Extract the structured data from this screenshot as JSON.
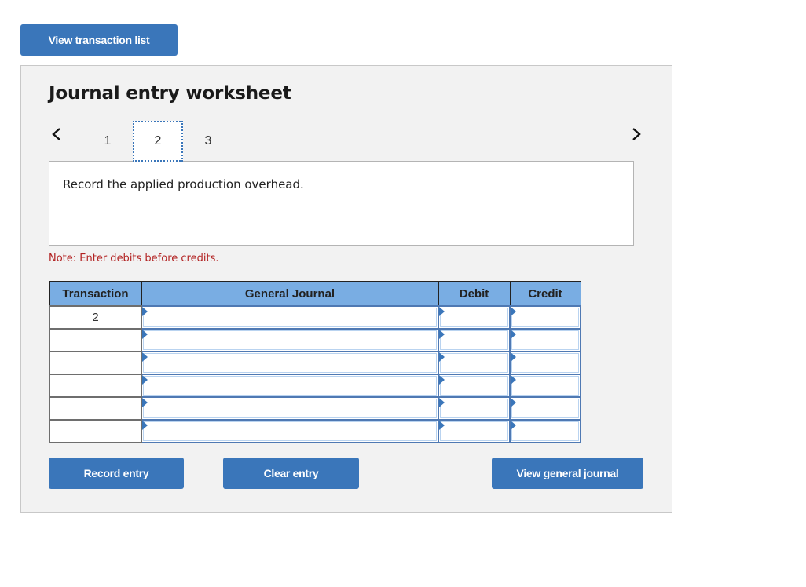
{
  "top_button": {
    "label": "View transaction list"
  },
  "worksheet": {
    "title": "Journal entry worksheet",
    "pages": [
      "1",
      "2",
      "3"
    ],
    "active_page": "2",
    "instruction": "Record the applied production overhead.",
    "note": "Note: Enter debits before credits."
  },
  "table": {
    "headers": {
      "transaction": "Transaction",
      "general_journal": "General Journal",
      "debit": "Debit",
      "credit": "Credit"
    },
    "rows": [
      {
        "transaction": "2",
        "account": "",
        "debit": "",
        "credit": ""
      },
      {
        "transaction": "",
        "account": "",
        "debit": "",
        "credit": ""
      },
      {
        "transaction": "",
        "account": "",
        "debit": "",
        "credit": ""
      },
      {
        "transaction": "",
        "account": "",
        "debit": "",
        "credit": ""
      },
      {
        "transaction": "",
        "account": "",
        "debit": "",
        "credit": ""
      },
      {
        "transaction": "",
        "account": "",
        "debit": "",
        "credit": ""
      }
    ]
  },
  "buttons": {
    "record": "Record entry",
    "clear": "Clear entry",
    "view_journal": "View general journal"
  },
  "colors": {
    "button_blue": "#3a76ba",
    "header_blue": "#79ade3",
    "note_red": "#b22222",
    "panel_bg": "#f2f2f2"
  }
}
